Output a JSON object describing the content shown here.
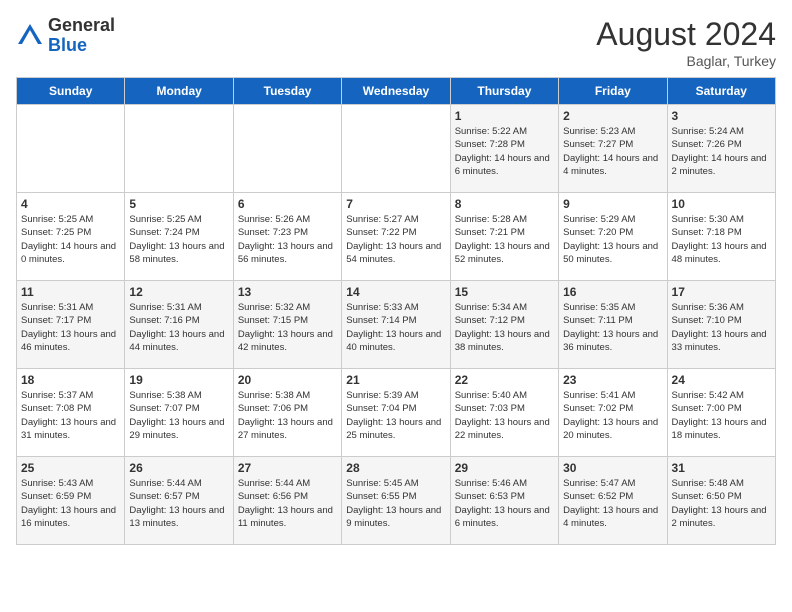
{
  "header": {
    "logo_general": "General",
    "logo_blue": "Blue",
    "month_year": "August 2024",
    "location": "Baglar, Turkey"
  },
  "days_of_week": [
    "Sunday",
    "Monday",
    "Tuesday",
    "Wednesday",
    "Thursday",
    "Friday",
    "Saturday"
  ],
  "weeks": [
    [
      {
        "day": "",
        "info": ""
      },
      {
        "day": "",
        "info": ""
      },
      {
        "day": "",
        "info": ""
      },
      {
        "day": "",
        "info": ""
      },
      {
        "day": "1",
        "sunrise": "Sunrise: 5:22 AM",
        "sunset": "Sunset: 7:28 PM",
        "daylight": "Daylight: 14 hours and 6 minutes."
      },
      {
        "day": "2",
        "sunrise": "Sunrise: 5:23 AM",
        "sunset": "Sunset: 7:27 PM",
        "daylight": "Daylight: 14 hours and 4 minutes."
      },
      {
        "day": "3",
        "sunrise": "Sunrise: 5:24 AM",
        "sunset": "Sunset: 7:26 PM",
        "daylight": "Daylight: 14 hours and 2 minutes."
      }
    ],
    [
      {
        "day": "4",
        "sunrise": "Sunrise: 5:25 AM",
        "sunset": "Sunset: 7:25 PM",
        "daylight": "Daylight: 14 hours and 0 minutes."
      },
      {
        "day": "5",
        "sunrise": "Sunrise: 5:25 AM",
        "sunset": "Sunset: 7:24 PM",
        "daylight": "Daylight: 13 hours and 58 minutes."
      },
      {
        "day": "6",
        "sunrise": "Sunrise: 5:26 AM",
        "sunset": "Sunset: 7:23 PM",
        "daylight": "Daylight: 13 hours and 56 minutes."
      },
      {
        "day": "7",
        "sunrise": "Sunrise: 5:27 AM",
        "sunset": "Sunset: 7:22 PM",
        "daylight": "Daylight: 13 hours and 54 minutes."
      },
      {
        "day": "8",
        "sunrise": "Sunrise: 5:28 AM",
        "sunset": "Sunset: 7:21 PM",
        "daylight": "Daylight: 13 hours and 52 minutes."
      },
      {
        "day": "9",
        "sunrise": "Sunrise: 5:29 AM",
        "sunset": "Sunset: 7:20 PM",
        "daylight": "Daylight: 13 hours and 50 minutes."
      },
      {
        "day": "10",
        "sunrise": "Sunrise: 5:30 AM",
        "sunset": "Sunset: 7:18 PM",
        "daylight": "Daylight: 13 hours and 48 minutes."
      }
    ],
    [
      {
        "day": "11",
        "sunrise": "Sunrise: 5:31 AM",
        "sunset": "Sunset: 7:17 PM",
        "daylight": "Daylight: 13 hours and 46 minutes."
      },
      {
        "day": "12",
        "sunrise": "Sunrise: 5:31 AM",
        "sunset": "Sunset: 7:16 PM",
        "daylight": "Daylight: 13 hours and 44 minutes."
      },
      {
        "day": "13",
        "sunrise": "Sunrise: 5:32 AM",
        "sunset": "Sunset: 7:15 PM",
        "daylight": "Daylight: 13 hours and 42 minutes."
      },
      {
        "day": "14",
        "sunrise": "Sunrise: 5:33 AM",
        "sunset": "Sunset: 7:14 PM",
        "daylight": "Daylight: 13 hours and 40 minutes."
      },
      {
        "day": "15",
        "sunrise": "Sunrise: 5:34 AM",
        "sunset": "Sunset: 7:12 PM",
        "daylight": "Daylight: 13 hours and 38 minutes."
      },
      {
        "day": "16",
        "sunrise": "Sunrise: 5:35 AM",
        "sunset": "Sunset: 7:11 PM",
        "daylight": "Daylight: 13 hours and 36 minutes."
      },
      {
        "day": "17",
        "sunrise": "Sunrise: 5:36 AM",
        "sunset": "Sunset: 7:10 PM",
        "daylight": "Daylight: 13 hours and 33 minutes."
      }
    ],
    [
      {
        "day": "18",
        "sunrise": "Sunrise: 5:37 AM",
        "sunset": "Sunset: 7:08 PM",
        "daylight": "Daylight: 13 hours and 31 minutes."
      },
      {
        "day": "19",
        "sunrise": "Sunrise: 5:38 AM",
        "sunset": "Sunset: 7:07 PM",
        "daylight": "Daylight: 13 hours and 29 minutes."
      },
      {
        "day": "20",
        "sunrise": "Sunrise: 5:38 AM",
        "sunset": "Sunset: 7:06 PM",
        "daylight": "Daylight: 13 hours and 27 minutes."
      },
      {
        "day": "21",
        "sunrise": "Sunrise: 5:39 AM",
        "sunset": "Sunset: 7:04 PM",
        "daylight": "Daylight: 13 hours and 25 minutes."
      },
      {
        "day": "22",
        "sunrise": "Sunrise: 5:40 AM",
        "sunset": "Sunset: 7:03 PM",
        "daylight": "Daylight: 13 hours and 22 minutes."
      },
      {
        "day": "23",
        "sunrise": "Sunrise: 5:41 AM",
        "sunset": "Sunset: 7:02 PM",
        "daylight": "Daylight: 13 hours and 20 minutes."
      },
      {
        "day": "24",
        "sunrise": "Sunrise: 5:42 AM",
        "sunset": "Sunset: 7:00 PM",
        "daylight": "Daylight: 13 hours and 18 minutes."
      }
    ],
    [
      {
        "day": "25",
        "sunrise": "Sunrise: 5:43 AM",
        "sunset": "Sunset: 6:59 PM",
        "daylight": "Daylight: 13 hours and 16 minutes."
      },
      {
        "day": "26",
        "sunrise": "Sunrise: 5:44 AM",
        "sunset": "Sunset: 6:57 PM",
        "daylight": "Daylight: 13 hours and 13 minutes."
      },
      {
        "day": "27",
        "sunrise": "Sunrise: 5:44 AM",
        "sunset": "Sunset: 6:56 PM",
        "daylight": "Daylight: 13 hours and 11 minutes."
      },
      {
        "day": "28",
        "sunrise": "Sunrise: 5:45 AM",
        "sunset": "Sunset: 6:55 PM",
        "daylight": "Daylight: 13 hours and 9 minutes."
      },
      {
        "day": "29",
        "sunrise": "Sunrise: 5:46 AM",
        "sunset": "Sunset: 6:53 PM",
        "daylight": "Daylight: 13 hours and 6 minutes."
      },
      {
        "day": "30",
        "sunrise": "Sunrise: 5:47 AM",
        "sunset": "Sunset: 6:52 PM",
        "daylight": "Daylight: 13 hours and 4 minutes."
      },
      {
        "day": "31",
        "sunrise": "Sunrise: 5:48 AM",
        "sunset": "Sunset: 6:50 PM",
        "daylight": "Daylight: 13 hours and 2 minutes."
      }
    ]
  ]
}
